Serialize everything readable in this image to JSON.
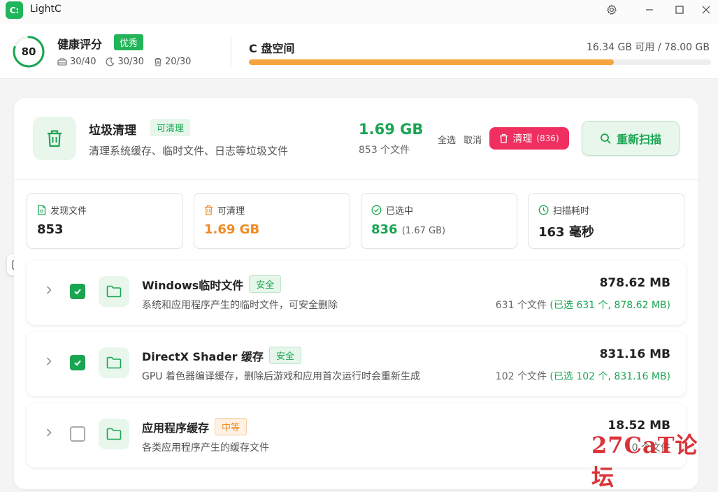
{
  "app": {
    "logo_text": "C:",
    "title": "LightC"
  },
  "health": {
    "score": "80",
    "score_fraction": 0.8,
    "title": "健康评分",
    "grade": "优秀",
    "stats": [
      {
        "icon": "disk-icon",
        "text": "30/40"
      },
      {
        "icon": "moon-icon",
        "text": "30/30"
      },
      {
        "icon": "trash-icon",
        "text": "20/30"
      }
    ]
  },
  "disk": {
    "title": "C 盘空间",
    "usage": "16.34 GB 可用 / 78.00 GB",
    "used_fraction": 0.79
  },
  "junk": {
    "title": "垃圾清理",
    "status": "可清理",
    "desc": "清理系统缓存、临时文件、日志等垃圾文件",
    "total_size": "1.69 GB",
    "total_count": "853 个文件",
    "select_all": "全选",
    "cancel": "取消",
    "clean_label": "清理",
    "clean_count": "(836)",
    "rescan_label": "重新扫描"
  },
  "stats": [
    {
      "icon": "file-icon",
      "label": "发现文件",
      "value": "853",
      "sub": "",
      "style": ""
    },
    {
      "icon": "trash-icon",
      "label": "可清理",
      "value": "1.69 GB",
      "sub": "",
      "style": "orange"
    },
    {
      "icon": "check-circle-icon",
      "label": "已选中",
      "value": "836",
      "sub": "(1.67 GB)",
      "style": "green"
    },
    {
      "icon": "clock-icon",
      "label": "扫描耗时",
      "value": "163 毫秒",
      "sub": "",
      "style": ""
    }
  ],
  "categories": [
    {
      "name": "Windows临时文件",
      "level": "安全",
      "level_type": "safe",
      "desc": "系统和应用程序产生的临时文件，可安全删除",
      "size": "878.62 MB",
      "files": "631 个文件",
      "selected": "(已选 631 个, 878.62 MB)",
      "checked": true
    },
    {
      "name": "DirectX Shader 缓存",
      "level": "安全",
      "level_type": "safe",
      "desc": "GPU 着色器编译缓存，删除后游戏和应用首次运行时会重新生成",
      "size": "831.16 MB",
      "files": "102 个文件",
      "selected": "(已选 102 个, 831.16 MB)",
      "checked": true
    },
    {
      "name": "应用程序缓存",
      "level": "中等",
      "level_type": "mid",
      "desc": "各类应用程序产生的缓存文件",
      "size": "18.52 MB",
      "files": "10 个文件",
      "selected": "",
      "checked": false
    }
  ],
  "watermark": "27CaT论坛",
  "colors": {
    "accent": "#1aa552",
    "danger": "#ef2f60",
    "warning": "#f08a24",
    "disk_bar": "#f5a440"
  }
}
